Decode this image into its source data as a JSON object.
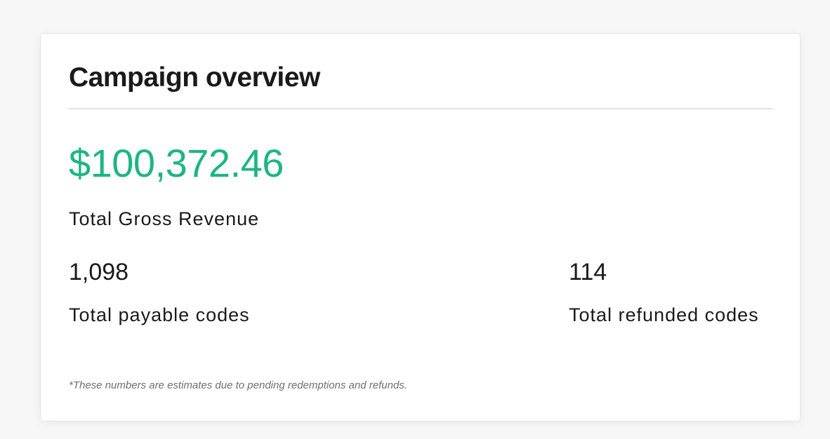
{
  "card": {
    "title": "Campaign overview",
    "revenue": {
      "value": "$100,372.46",
      "label": "Total Gross Revenue",
      "color": "#1db585"
    },
    "stats": [
      {
        "value": "1,098",
        "label": "Total payable codes"
      },
      {
        "value": "114",
        "label": "Total refunded codes"
      }
    ],
    "footnote": "*These numbers are estimates due to pending redemptions and refunds."
  }
}
